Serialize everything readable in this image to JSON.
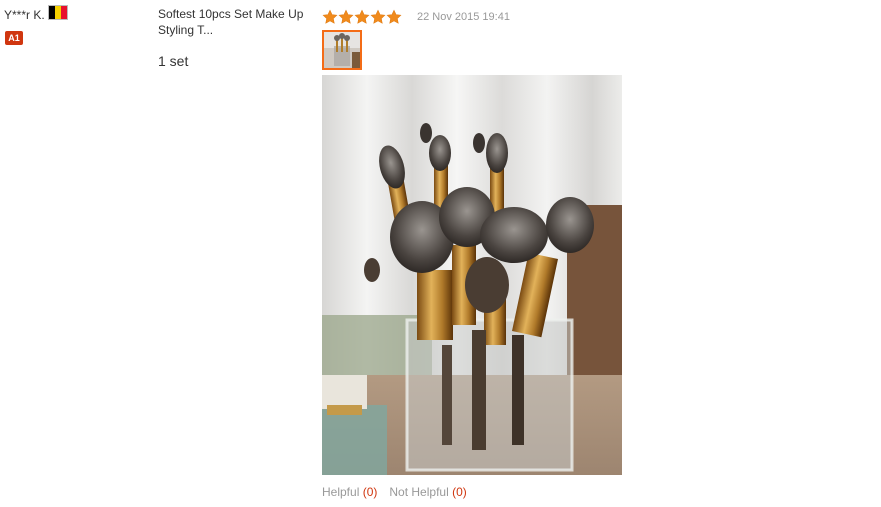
{
  "buyer": {
    "name": "Y***r K.",
    "flag_icon": "belgium-flag-icon",
    "flag_colors": [
      "#000000",
      "#f5d000",
      "#e8112d"
    ],
    "level_badge": "A1"
  },
  "product": {
    "title": "Softest 10pcs Set Make Up Styling T...",
    "quantity": "1 set"
  },
  "review": {
    "rating": 5,
    "rating_max": 5,
    "star_icon": "star-icon",
    "star_color": "#f08a1c",
    "date": "22 Nov 2015 19:41",
    "photo_icon": "review-photo-thumbnail",
    "photo_subject": "makeup-brushes-in-glass-jar-photo"
  },
  "votes": {
    "helpful_label": "Helpful",
    "helpful_count": "(0)",
    "not_helpful_label": "Not Helpful",
    "not_helpful_count": "(0)"
  },
  "colors": {
    "accent": "#d0360f",
    "muted_text": "#999999",
    "thumb_border": "#f46c17"
  }
}
